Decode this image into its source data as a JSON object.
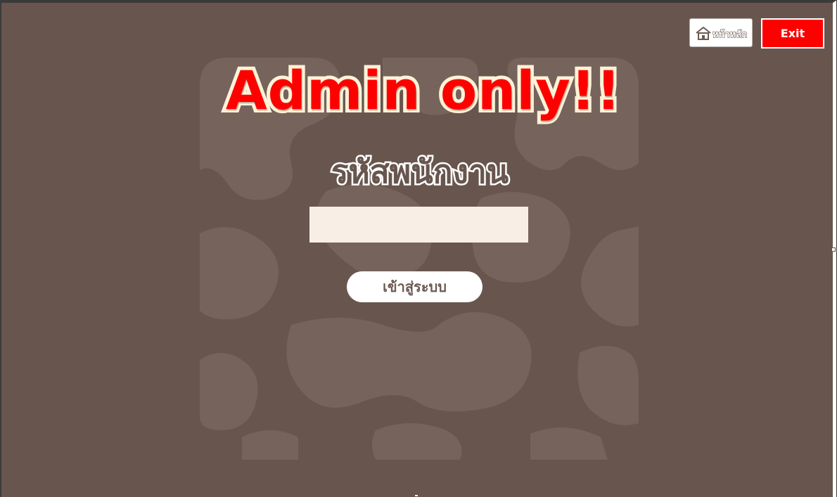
{
  "header": {
    "home_label": "หน้าหลัก",
    "home_icon": "home-icon",
    "exit_label": "Exit"
  },
  "main": {
    "title": "Admin only!!",
    "field_label": "รหัสพนักงาน",
    "employee_id_value": "",
    "login_label": "เข้าสู่ระบบ"
  },
  "colors": {
    "background": "#68564e",
    "pattern": "#76645c",
    "accent_red": "#ff0000",
    "title_outline": "#fbf2d8",
    "input_background": "#f9eee5"
  }
}
